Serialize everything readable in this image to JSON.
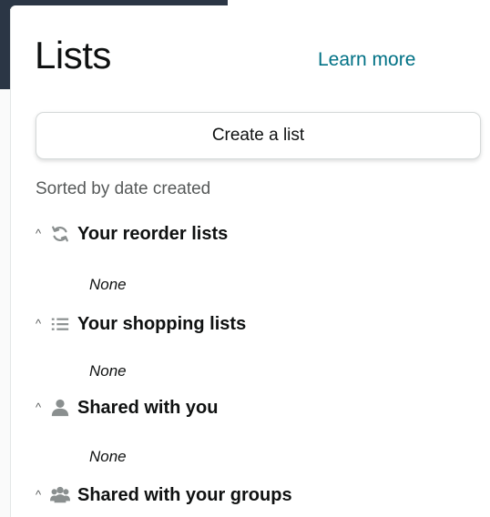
{
  "panel": {
    "title": "Lists",
    "learn_more": "Learn more",
    "create_button": "Create a list",
    "sort_label": "Sorted by date created"
  },
  "sections": [
    {
      "title": "Your reorder lists",
      "icon": "reorder-icon",
      "caret": "^",
      "empty_text": "None"
    },
    {
      "title": "Your shopping lists",
      "icon": "list-icon",
      "caret": "^",
      "empty_text": "None"
    },
    {
      "title": "Shared with you",
      "icon": "person-icon",
      "caret": "^",
      "empty_text": "None"
    },
    {
      "title": "Shared with your groups",
      "icon": "group-icon",
      "caret": "^"
    }
  ],
  "colors": {
    "link": "#007185",
    "muted_text": "#565959",
    "icon_gray": "#8a8f8f",
    "header_bar": "#2b3645"
  }
}
